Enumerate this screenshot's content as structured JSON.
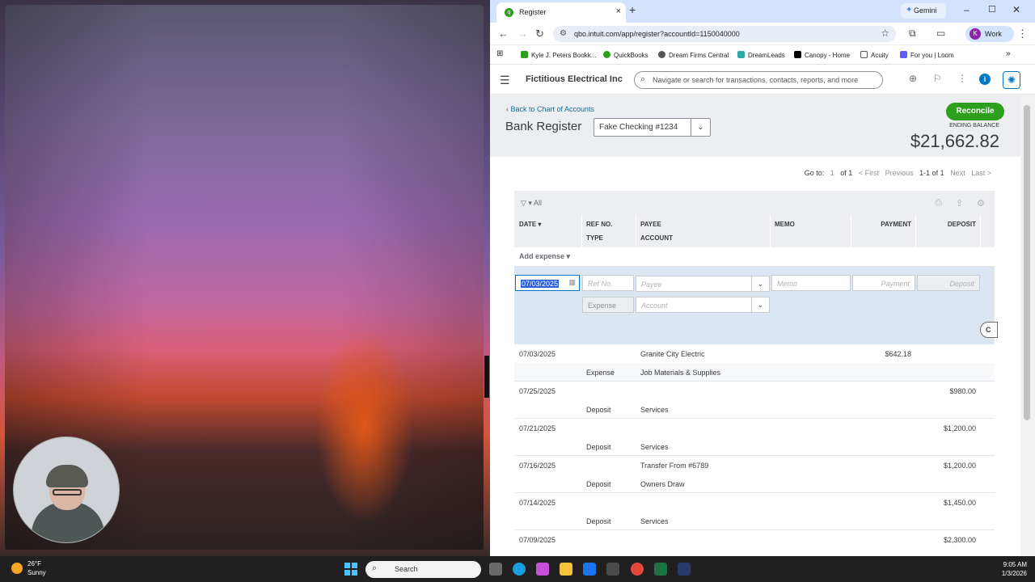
{
  "browser": {
    "tab_title": "Register",
    "gemini": "Gemini",
    "url": "qbo.intuit.com/app/register?accountId=1150040000",
    "profile": "Work",
    "profile_initial": "K",
    "bookmarks": [
      "Kyle J. Peters Bookk...",
      "QuickBooks",
      "Dream Firms Central",
      "DreamLeads",
      "Canopy - Home",
      "Acuity",
      "For you | Loom"
    ],
    "bookmarks_more": "»"
  },
  "qbo": {
    "company": "Fictitious Electrical Inc",
    "search_placeholder": "Navigate or search for transactions, contacts, reports, and more",
    "back_link": "Back to Chart of Accounts",
    "page_title": "Bank Register",
    "account": "Fake Checking #1234",
    "reconcile": "Reconcile",
    "ending_balance_label": "ENDING BALANCE",
    "ending_balance": "$21,662.82",
    "pager": {
      "goto": "Go to:",
      "page": "1",
      "of": "of 1",
      "first": "< First",
      "previous": "Previous",
      "range": "1-1 of 1",
      "next": "Next",
      "last": "Last >"
    },
    "filter": "All",
    "columns": {
      "date": "DATE",
      "ref": "REF NO.",
      "type": "TYPE",
      "payee": "PAYEE",
      "account": "ACCOUNT",
      "memo": "MEMO",
      "payment": "PAYMENT",
      "deposit": "DEPOSIT"
    },
    "add_expense": "Add expense",
    "edit": {
      "date": "07/03/2025",
      "ref": "Ref No.",
      "payee": "Payee",
      "memo": "Memo",
      "payment": "Payment",
      "deposit": "Deposit",
      "type": "Expense",
      "account": "Account",
      "cancel": "C"
    },
    "rows": [
      {
        "date": "07/03/2025",
        "payee": "Granite City Electric",
        "payment": "$642.18",
        "deposit": "",
        "type": "Expense",
        "account": "Job Materials & Supplies"
      },
      {
        "date": "07/25/2025",
        "payee": "",
        "payment": "",
        "deposit": "$980.00",
        "type": "Deposit",
        "account": "Services"
      },
      {
        "date": "07/21/2025",
        "payee": "",
        "payment": "",
        "deposit": "$1,200.00",
        "type": "Deposit",
        "account": "Services"
      },
      {
        "date": "07/16/2025",
        "payee": "Transfer From #6789",
        "payment": "",
        "deposit": "$1,200.00",
        "type": "Deposit",
        "account": "Owners Draw"
      },
      {
        "date": "07/14/2025",
        "payee": "",
        "payment": "",
        "deposit": "$1,450.00",
        "type": "Deposit",
        "account": "Services"
      },
      {
        "date": "07/09/2025",
        "payee": "",
        "payment": "",
        "deposit": "$2,300.00",
        "type": "",
        "account": ""
      }
    ]
  },
  "taskbar": {
    "temp": "26°F",
    "condition": "Sunny",
    "search": "Search",
    "time": "9:05 AM",
    "date": "1/3/2026"
  }
}
